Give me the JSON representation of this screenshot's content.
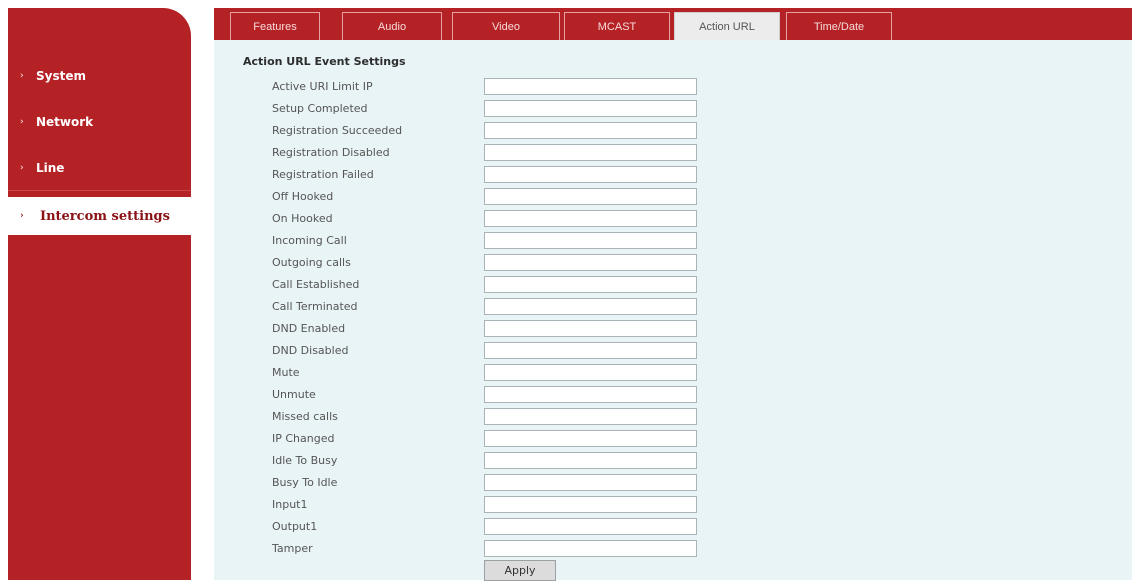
{
  "sidebar": {
    "items": [
      {
        "label": "System",
        "marker": "›",
        "active": false
      },
      {
        "label": "Network",
        "marker": "›",
        "active": false
      },
      {
        "label": "Line",
        "marker": "›",
        "active": false
      },
      {
        "label": "Intercom settings",
        "marker": "›",
        "active": true
      }
    ]
  },
  "tabs": [
    {
      "label": "Features",
      "active": false
    },
    {
      "label": "Audio",
      "active": false
    },
    {
      "label": "Video",
      "active": false
    },
    {
      "label": "MCAST",
      "active": false
    },
    {
      "label": "Action URL",
      "active": true
    },
    {
      "label": "Time/Date",
      "active": false
    }
  ],
  "section": {
    "title": "Action URL Event Settings"
  },
  "fields": [
    {
      "label": "Active URI Limit IP",
      "value": ""
    },
    {
      "label": "Setup Completed",
      "value": ""
    },
    {
      "label": "Registration Succeeded",
      "value": ""
    },
    {
      "label": "Registration Disabled",
      "value": ""
    },
    {
      "label": "Registration Failed",
      "value": ""
    },
    {
      "label": "Off Hooked",
      "value": ""
    },
    {
      "label": "On Hooked",
      "value": ""
    },
    {
      "label": "Incoming Call",
      "value": ""
    },
    {
      "label": "Outgoing calls",
      "value": ""
    },
    {
      "label": "Call Established",
      "value": ""
    },
    {
      "label": "Call Terminated",
      "value": ""
    },
    {
      "label": "DND Enabled",
      "value": ""
    },
    {
      "label": "DND Disabled",
      "value": ""
    },
    {
      "label": "Mute",
      "value": ""
    },
    {
      "label": "Unmute",
      "value": ""
    },
    {
      "label": "Missed calls",
      "value": ""
    },
    {
      "label": "IP Changed",
      "value": ""
    },
    {
      "label": "Idle To Busy",
      "value": ""
    },
    {
      "label": "Busy To Idle",
      "value": ""
    },
    {
      "label": "Input1",
      "value": ""
    },
    {
      "label": "Output1",
      "value": ""
    },
    {
      "label": "Tamper",
      "value": ""
    }
  ],
  "actions": {
    "apply_label": "Apply"
  },
  "colors": {
    "brand_red": "#b52226",
    "content_bg": "#e9f4f7",
    "active_tab_bg": "#ececec"
  }
}
